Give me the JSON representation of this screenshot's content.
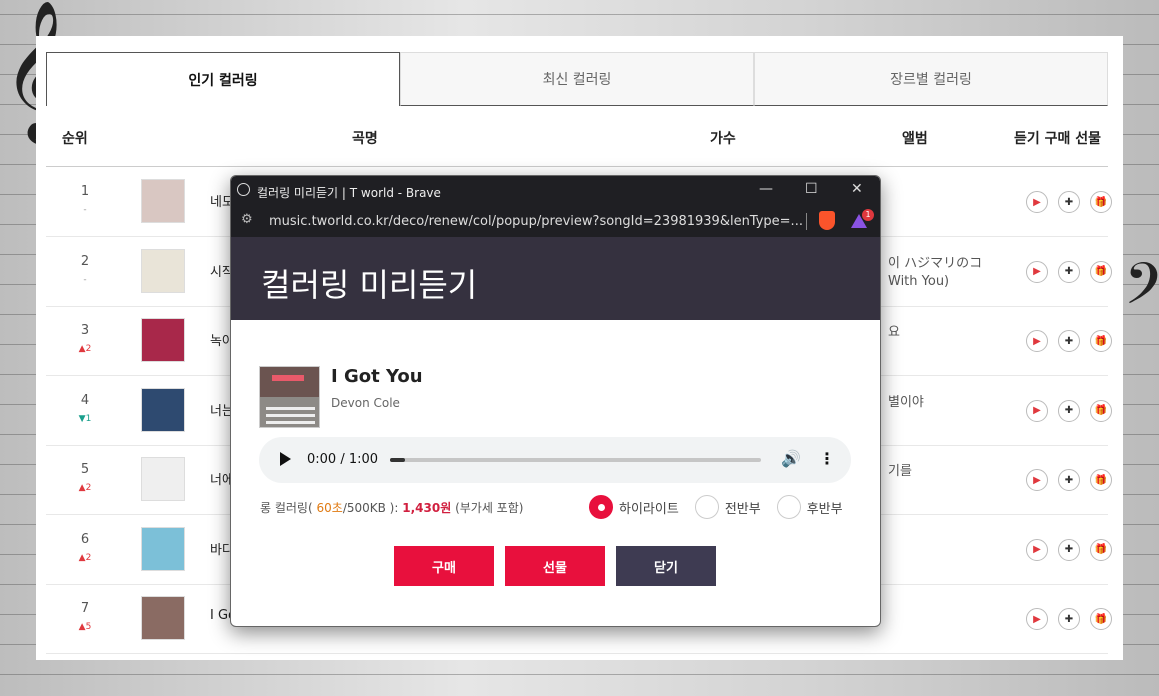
{
  "tabs": [
    "인기 컬러링",
    "최신 컬러링",
    "장르별 컬러링"
  ],
  "table_header": {
    "rank": "순위",
    "song": "곡명",
    "artist": "가수",
    "album": "앨범",
    "actions": "듣기 구매 선물"
  },
  "rows": [
    {
      "rank": "1",
      "delta": "-",
      "delta_type": "same",
      "title": "네모",
      "album": "",
      "thumb_color": "#d9c7c2"
    },
    {
      "rank": "2",
      "delta": "-",
      "delta_type": "same",
      "title": "시작",
      "album": "이 ハジマリのコ\nWith You)",
      "thumb_color": "#e9e4d8"
    },
    {
      "rank": "3",
      "delta": "▲2",
      "delta_type": "up",
      "title": "녹아",
      "album": "요",
      "thumb_color": "#a8284a"
    },
    {
      "rank": "4",
      "delta": "▼1",
      "delta_type": "down",
      "title": "너는",
      "album": "별이야",
      "thumb_color": "#2e4a70"
    },
    {
      "rank": "5",
      "delta": "▲2",
      "delta_type": "up",
      "title": "너에",
      "album": "기를",
      "thumb_color": "#efefef"
    },
    {
      "rank": "6",
      "delta": "▲2",
      "delta_type": "up",
      "title": "바다",
      "album": "",
      "thumb_color": "#7cc0d8"
    },
    {
      "rank": "7",
      "delta": "▲5",
      "delta_type": "up",
      "title": "I Got",
      "album": "",
      "thumb_color": "#8a6b63"
    }
  ],
  "icons": {
    "play": "play-icon",
    "add": "plus-icon",
    "gift": "gift-icon"
  },
  "popup": {
    "window_title": "컬러링 미리듣기 | T world - Brave",
    "url": "music.tworld.co.kr/deco/renew/col/popup/preview?songId=23981939&lenType=...",
    "extension_badge": "1",
    "heading": "컬러링 미리듣기",
    "song_title": "I Got You",
    "song_artist": "Devon Cole",
    "player_time": "0:00 / 1:00",
    "progress": 0.04,
    "info_prefix": "롱 컬러링(",
    "info_seconds": "60초",
    "info_mid": "/500KB ):",
    "info_price": "1,430원",
    "info_suffix": "(부가세 포함)",
    "options": [
      "하이라이트",
      "전반부",
      "후반부"
    ],
    "selected_option": 0,
    "buttons": {
      "buy": "구매",
      "gift": "선물",
      "close": "닫기"
    }
  },
  "colors": {
    "accent_red": "#e8103d",
    "header_dark": "#35313f",
    "button_dark": "#3e3b52"
  }
}
